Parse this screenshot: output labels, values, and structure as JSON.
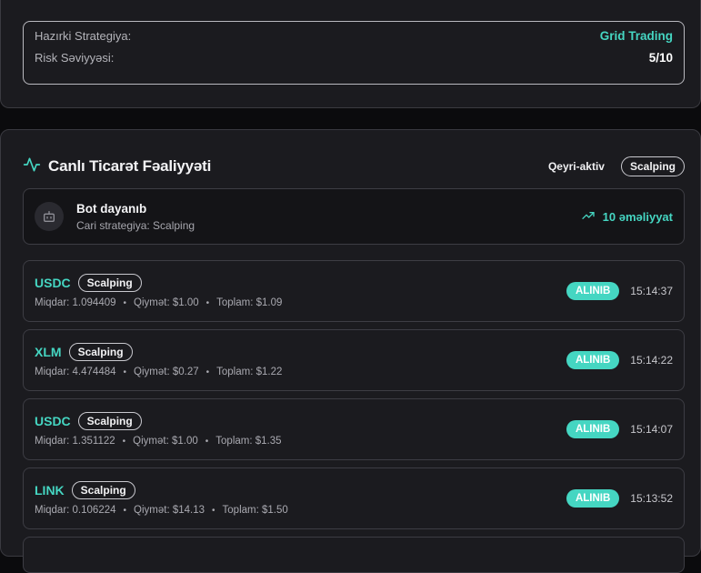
{
  "strategy": {
    "current_label": "Hazırki Strategiya:",
    "current_value": "Grid Trading",
    "risk_label": "Risk Səviyyəsi:",
    "risk_value": "5/10"
  },
  "activity": {
    "title": "Canlı Ticarət Fəaliyyəti",
    "status": "Qeyri-aktiv",
    "strategy_pill": "Scalping",
    "bot_title": "Bot dayanıb",
    "bot_subtitle": "Cari strategiya: Scalping",
    "operations": "10 əməliyyat"
  },
  "trades": [
    {
      "symbol": "USDC",
      "strategy": "Scalping",
      "qty": "Miqdar: 1.094409",
      "price": "Qiymət: $1.00",
      "total": "Toplam: $1.09",
      "side": "ALINIB",
      "time": "15:14:37"
    },
    {
      "symbol": "XLM",
      "strategy": "Scalping",
      "qty": "Miqdar: 4.474484",
      "price": "Qiymət: $0.27",
      "total": "Toplam: $1.22",
      "side": "ALINIB",
      "time": "15:14:22"
    },
    {
      "symbol": "USDC",
      "strategy": "Scalping",
      "qty": "Miqdar: 1.351122",
      "price": "Qiymət: $1.00",
      "total": "Toplam: $1.35",
      "side": "ALINIB",
      "time": "15:14:07"
    },
    {
      "symbol": "LINK",
      "strategy": "Scalping",
      "qty": "Miqdar: 0.106224",
      "price": "Qiymət: $14.13",
      "total": "Toplam: $1.50",
      "side": "ALINIB",
      "time": "15:13:52"
    }
  ],
  "colors": {
    "accent": "#45d6c2",
    "card_bg": "#1b1b1f",
    "page_bg": "#0b0b0d"
  },
  "icons": {
    "activity": "activity-pulse-icon",
    "bot": "bot-icon",
    "trend": "trending-up-icon"
  }
}
